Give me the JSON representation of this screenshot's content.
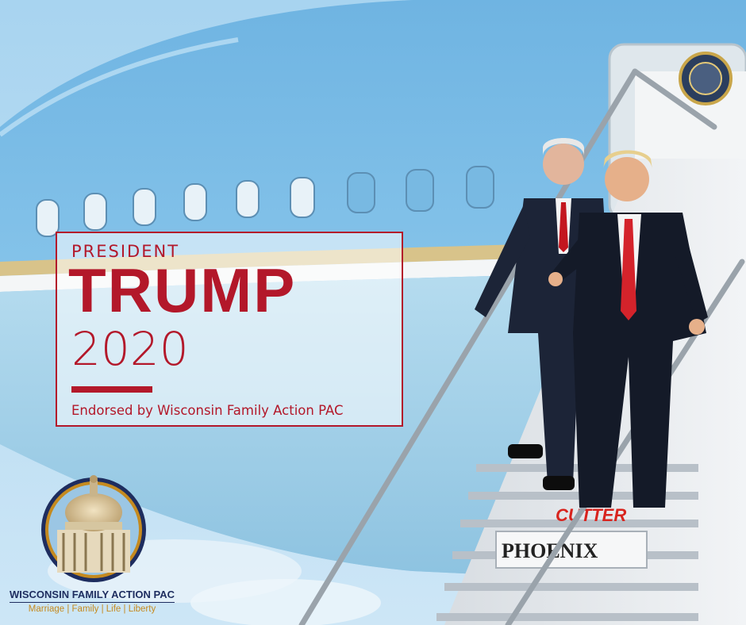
{
  "endorsement": {
    "kicker": "PRESIDENT",
    "headline": "TRUMP",
    "year": "2020",
    "subline": "Endorsed by Wisconsin Family Action PAC"
  },
  "aircraft": {
    "stair_brand": "CUTTER",
    "stair_model": "PHOENIX"
  },
  "organization": {
    "name": "WISCONSIN FAMILY ACTION PAC",
    "tagline": "Marriage | Family | Life | Liberty"
  },
  "colors": {
    "brand_red": "#b3182a",
    "navy": "#1e2d5f",
    "gold": "#c58a1f",
    "sky_blue": "#8ec3e6"
  }
}
